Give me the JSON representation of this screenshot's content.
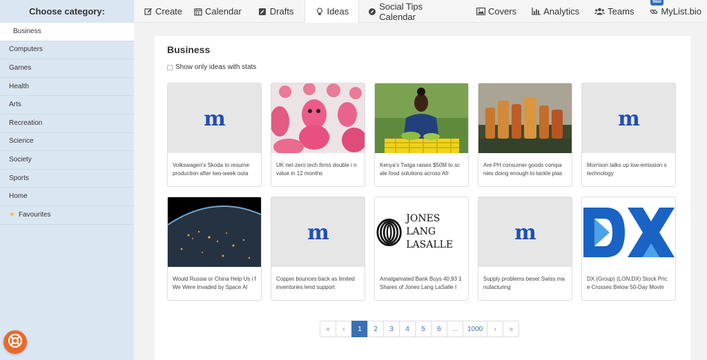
{
  "sidebar": {
    "heading": "Choose category:",
    "items": [
      {
        "label": "Business",
        "active": true
      },
      {
        "label": "Computers"
      },
      {
        "label": "Games"
      },
      {
        "label": "Health"
      },
      {
        "label": "Arts"
      },
      {
        "label": "Recreation"
      },
      {
        "label": "Science"
      },
      {
        "label": "Society"
      },
      {
        "label": "Sports"
      },
      {
        "label": "Home"
      },
      {
        "label": "Favourites",
        "icon": "star-icon"
      }
    ]
  },
  "nav": {
    "items": [
      {
        "label": "Create",
        "icon": "edit-icon"
      },
      {
        "label": "Calendar",
        "icon": "calendar-icon"
      },
      {
        "label": "Drafts",
        "icon": "drafts-icon"
      },
      {
        "label": "Ideas",
        "icon": "lightbulb-icon",
        "active": true
      },
      {
        "label": "Social Tips Calendar",
        "icon": "compass-icon"
      },
      {
        "label": "Covers",
        "icon": "image-icon"
      },
      {
        "label": "Analytics",
        "icon": "bar-chart-icon"
      },
      {
        "label": "Teams",
        "icon": "users-icon"
      },
      {
        "label": "MyList.bio",
        "icon": "link-icon",
        "badge": "New"
      }
    ]
  },
  "main": {
    "title": "Business",
    "stats_label": "Show only ideas with stats",
    "cards": [
      {
        "caption": "Volkswagen's Skoda to resume production after two-week outa",
        "thumb": "m-logo"
      },
      {
        "caption": "UK net-zero tech firms double i n value in 12 months",
        "thumb": "pink-toys"
      },
      {
        "caption": "Kenya's Twiga raises $50M to sc ale food solutions across Afr",
        "thumb": "woman-crate"
      },
      {
        "caption": "Are PH consumer goods compa nies doing enough to tackle plas",
        "thumb": "bottles"
      },
      {
        "caption": "Morrison talks up low-emission s technology",
        "thumb": "m-logo"
      },
      {
        "caption": "Would Russia or China Help Us i f We Were Invaded by Space Al",
        "thumb": "earth-night"
      },
      {
        "caption": "Copper bounces back as limited inventories lend support",
        "thumb": "m-logo"
      },
      {
        "caption": "Amalgamated Bank Buys 40,93 1 Shares of Jones Lang LaSalle I",
        "thumb": "jll-logo",
        "logo_line1": "JONES LANG",
        "logo_line2": "LASALLE"
      },
      {
        "caption": "Supply problems beset Swiss ma nufacturing",
        "thumb": "m-logo"
      },
      {
        "caption": "DX (Group) (LON:DX) Stock Pric e Crosses Below 50-Day Movin",
        "thumb": "dx-logo"
      }
    ],
    "pagination": [
      "«",
      "‹",
      "1",
      "2",
      "3",
      "4",
      "5",
      "6",
      "...",
      "1000",
      "›",
      "»"
    ],
    "current_page": "1"
  },
  "colors": {
    "sidebar_bg": "#dbe6f3",
    "accent": "#3a70b3",
    "logo_blue": "#1f4fb5",
    "help_orange": "#e96a2c",
    "dx_blue": "#1a63c4"
  }
}
